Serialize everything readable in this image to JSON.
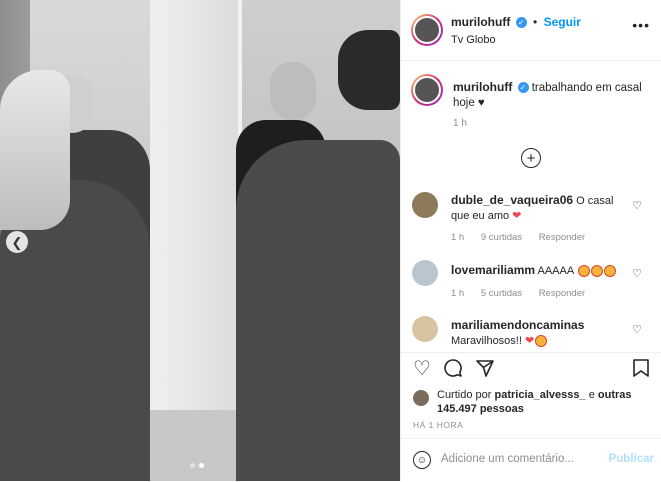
{
  "post": {
    "carousel": {
      "total_slides": 2,
      "active_slide": 2
    },
    "header": {
      "username": "murilohuff",
      "verified": true,
      "follow_label": "Seguir",
      "location": "Tv Globo",
      "more_glyph": "•••"
    },
    "caption": {
      "username": "murilohuff",
      "text": "trabalhando em casal hoje ♥",
      "time": "1 h"
    },
    "load_more_glyph": "+",
    "comments": [
      {
        "username": "duble_de_vaqueira06",
        "text": "O casal que eu amo",
        "emoji": "heart",
        "time": "1 h",
        "likes": "9 curtidas",
        "reply": "Responder"
      },
      {
        "username": "lovemariliamm",
        "text": "AAAAA",
        "emoji": "heart-eyes x3",
        "time": "1 h",
        "likes": "5 curtidas",
        "reply": "Responder"
      },
      {
        "username": "mariliamendoncaminas",
        "text": "Maravilhosos!!",
        "emoji": "heart + heart-eyes",
        "time": "",
        "likes": "",
        "reply": ""
      }
    ],
    "likes": {
      "prefix": "Curtido por",
      "user": "patricia_alvesss_",
      "connector": "e",
      "others": "outras 145.497 pessoas"
    },
    "timestamp": "HÁ 1 HORA",
    "add_comment": {
      "placeholder": "Adicione um comentário...",
      "post_label": "Publicar"
    },
    "icons": [
      "heart-icon",
      "comment-icon",
      "share-icon",
      "bookmark-icon",
      "emoji-icon",
      "verified-icon",
      "chevron-left-icon",
      "add-circle-icon"
    ],
    "colors": {
      "accent": "#0095f6",
      "verified": "#3897f0",
      "like": "#ed4956",
      "muted": "#8e8e8e",
      "post_disabled": "#b2dffc"
    }
  }
}
